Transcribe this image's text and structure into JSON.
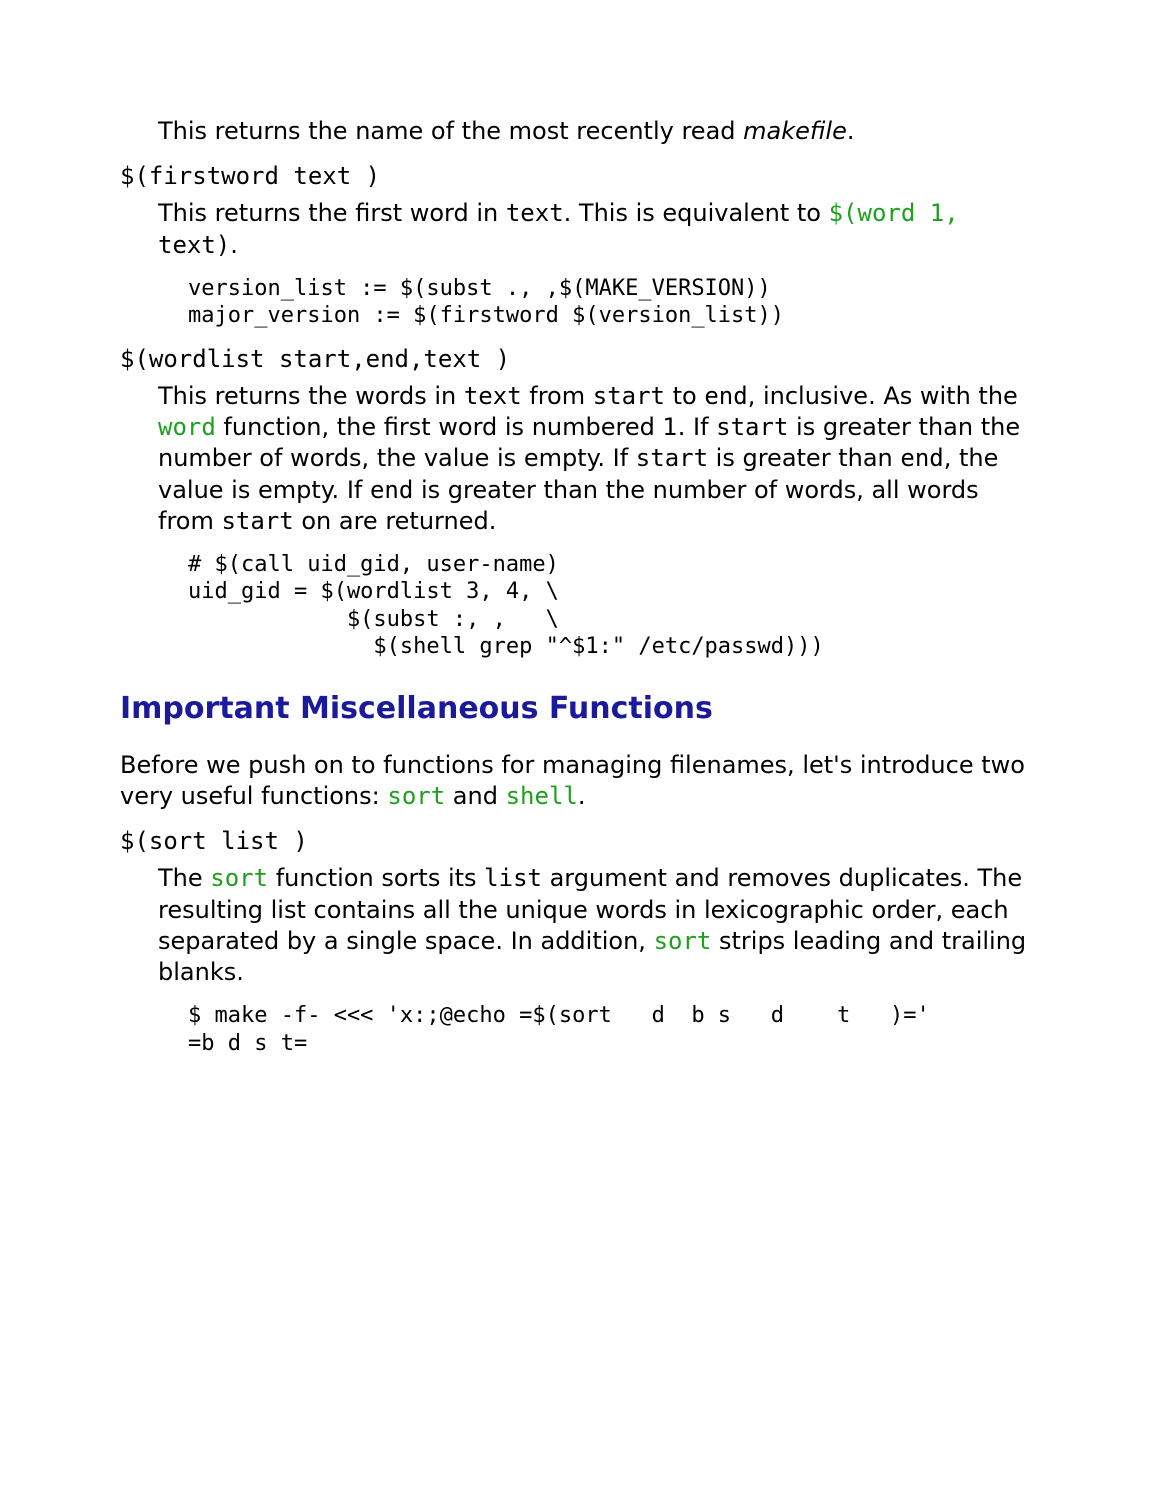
{
  "p_makefile_pre": "This returns the name of the most recently read ",
  "p_makefile_em": "makefile",
  "p_makefile_post": ".",
  "firstword_term": "$(firstword text )",
  "firstword_desc_pre": "This returns the first word in ",
  "firstword_desc_code1": "text",
  "firstword_desc_mid": ". This is equivalent to ",
  "firstword_desc_green": "$(word 1,",
  "firstword_desc_space": " ",
  "firstword_desc_code3": "text",
  "firstword_desc_paren": ")",
  "firstword_desc_post": ".",
  "firstword_code": "version_list := $(subst ., ,$(MAKE_VERSION))\nmajor_version := $(firstword $(version_list))",
  "wordlist_term": "$(wordlist start,end,text )",
  "wordlist_p1_a": "This returns the words in ",
  "wordlist_p1_c1": "text",
  "wordlist_p1_b": " from ",
  "wordlist_p1_c2": "start",
  "wordlist_p1_c": " to ",
  "wordlist_p1_c3": "end",
  "wordlist_p1_d": ", inclusive. As with the ",
  "wordlist_p1_green": "word",
  "wordlist_p1_e": " function, the first word is numbered 1. If ",
  "wordlist_p1_c4": "start",
  "wordlist_p1_f": " is greater than the number of words, the value is empty. If ",
  "wordlist_p1_c5": "start",
  "wordlist_p1_g": " is greater than ",
  "wordlist_p1_c6": "end",
  "wordlist_p1_h": ", the value is empty. If ",
  "wordlist_p1_c7": "end",
  "wordlist_p1_i": " is greater than the number of words, all words from ",
  "wordlist_p1_c8": "start",
  "wordlist_p1_j": " on are returned.",
  "wordlist_code": "# $(call uid_gid, user-name)\nuid_gid = $(wordlist 3, 4, \\\n            $(subst :, ,   \\\n              $(shell grep \"^$1:\" /etc/passwd)))",
  "section_heading": "Important Miscellaneous Functions",
  "intro_a": "Before we push on to functions for managing filenames, let's introduce two very useful functions: ",
  "intro_g1": "sort",
  "intro_b": " and ",
  "intro_g2": "shell",
  "intro_c": ".",
  "sort_term": "$(sort list )",
  "sort_p_a": "The ",
  "sort_p_g1": "sort",
  "sort_p_b": " function sorts its ",
  "sort_p_c1": "list",
  "sort_p_c": " argument and removes duplicates. The resulting list contains all the unique words in lexicographic order, each separated by a single space. In addition, ",
  "sort_p_g2": "sort",
  "sort_p_d": " strips leading and trailing blanks.",
  "sort_code": "$ make -f- <<< 'x:;@echo =$(sort   d  b s   d    t   )='\n=b d s t="
}
